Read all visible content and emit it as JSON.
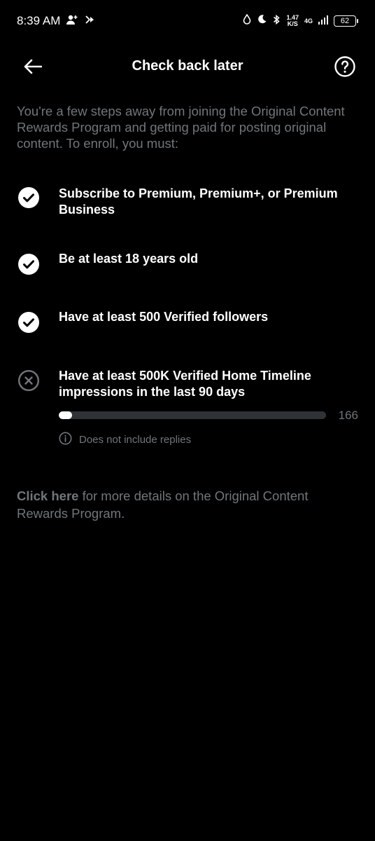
{
  "status_bar": {
    "time": "8:39 AM",
    "speed_value": "1.47",
    "speed_unit": "K/S",
    "network": "4G",
    "battery": "62"
  },
  "header": {
    "title": "Check back later"
  },
  "intro": "You're a few steps away from joining the Original Content Rewards Program and getting paid for posting original content. To enroll, you must:",
  "requirements": [
    {
      "text": "Subscribe to Premium, Premium+, or Premium Business",
      "status": "met"
    },
    {
      "text": "Be at least 18 years old",
      "status": "met"
    },
    {
      "text": "Have at least 500 Verified followers",
      "status": "met"
    },
    {
      "text": "Have at least 500K Verified Home Timeline impressions in the last 90 days",
      "status": "unmet"
    }
  ],
  "progress": {
    "value": "166",
    "fraction": 0.05,
    "note": "Does not include replies"
  },
  "footer": {
    "link_text": "Click here",
    "rest_text": " for more details on the Original Content Rewards Program."
  }
}
